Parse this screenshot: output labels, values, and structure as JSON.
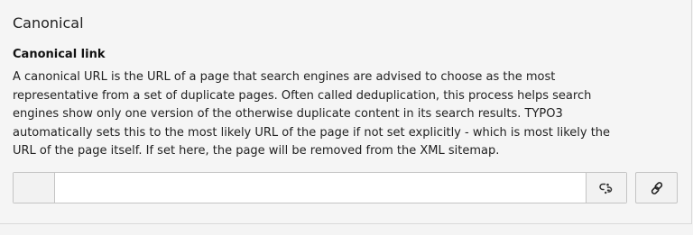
{
  "section": {
    "title": "Canonical"
  },
  "field": {
    "label": "Canonical link",
    "description_lines": [
      "A canonical URL is the URL of a page that search engines are advised to choose as the most",
      "representative from a set of duplicate pages. Often called deduplication, this process helps search",
      "engines show only one version of the otherwise duplicate content in its search results. TYPO3",
      "automatically sets this to the most likely URL of the page if not set explicitly - which is most likely the",
      "URL of the page itself. If set here, the page will be removed from the XML sitemap."
    ],
    "value": "",
    "placeholder": ""
  },
  "icons": {
    "clear": "unlink-icon",
    "browse": "link-icon"
  }
}
